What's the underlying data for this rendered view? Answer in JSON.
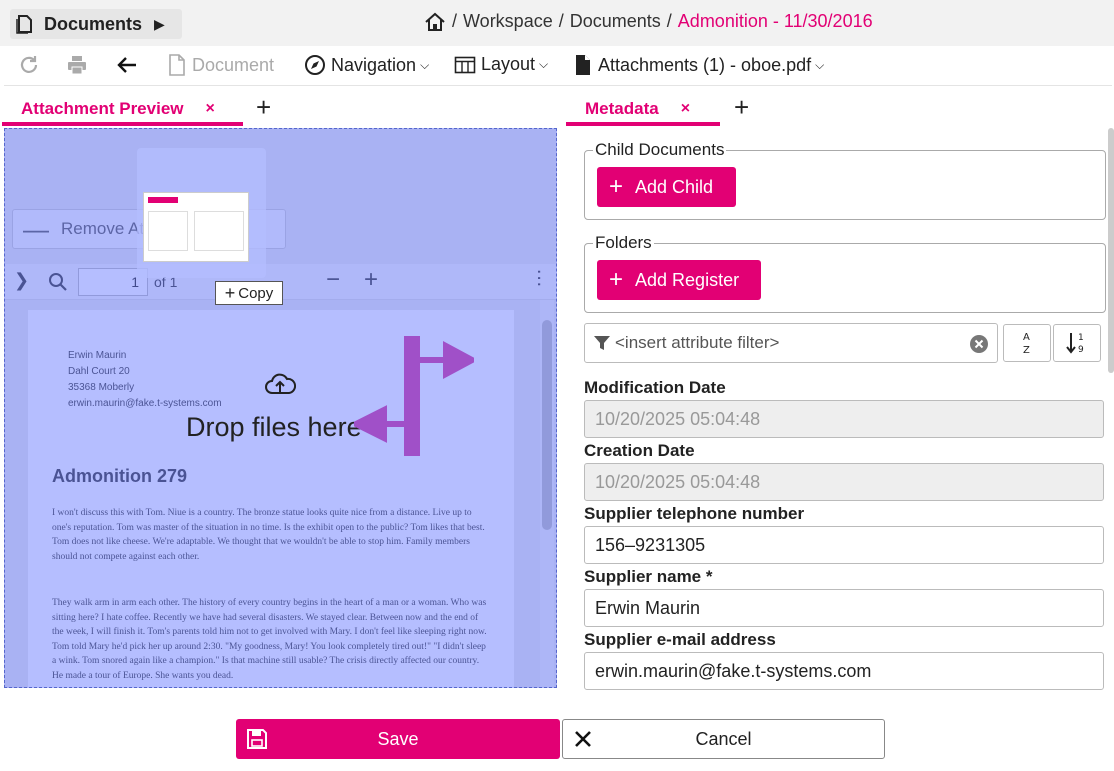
{
  "app": {
    "documents_label": "Documents"
  },
  "breadcrumb": {
    "items": [
      "Workspace",
      "Documents"
    ],
    "current": "Admonition - 11/30/2016",
    "separator": "/"
  },
  "toolbar": {
    "document_label": "Document",
    "navigation_label": "Navigation",
    "layout_label": "Layout",
    "attachments_label": "Attachments (1) - oboe.pdf"
  },
  "tabs": {
    "left": "Attachment Preview",
    "right": "Metadata",
    "close_glyph": "×",
    "add_glyph": "+"
  },
  "preview": {
    "remove_label": "Remove Attachment",
    "page_number": "1",
    "page_of": "of 1",
    "drop_text": "Drop files here",
    "copy_label": "Copy",
    "address": [
      "Erwin Maurin",
      "Dahl Court 20",
      "35368 Moberly",
      "erwin.maurin@fake.t-systems.com"
    ],
    "heading": "Admonition 279",
    "para1": "I won't discuss this with Tom. Niue is a country. The bronze statue looks quite nice from a distance. Live up to one's reputation. Tom was master of the situation in no time. Is the exhibit open to the public? Tom likes that best. Tom does not like cheese. We're adaptable. We thought that we wouldn't be able to stop him. Family members should not compete against each other.",
    "para2": "They walk arm in arm each other. The history of every country begins in the heart of a man or a woman. Who was sitting here? I hate coffee. Recently we have had several disasters. We stayed clear. Between now and the end of the week, I will finish it. Tom's parents told him not to get involved with Mary. I don't feel like sleeping right now. Tom told Mary he'd pick her up around 2:30. \"My goodness, Mary! You look completely tired out!\" \"I didn't sleep a wink. Tom snored again like a champion.\" Is that machine still usable? The crisis directly affected our country. He made a tour of Europe. She wants you dead."
  },
  "metadata": {
    "child_documents_legend": "Child Documents",
    "add_child_label": "Add Child",
    "folders_legend": "Folders",
    "add_register_label": "Add Register",
    "filter_placeholder": "<insert attribute filter>",
    "fields": [
      {
        "label": "Modification Date",
        "value": "10/20/2025 05:04:48"
      },
      {
        "label": "Creation Date",
        "value": "10/20/2025 05:04:48"
      },
      {
        "label": "Supplier telephone number",
        "value": "156–9231305"
      },
      {
        "label": "Supplier name *",
        "value": "Erwin Maurin"
      },
      {
        "label": "Supplier e-mail address",
        "value": "erwin.maurin@fake.t-systems.com"
      }
    ]
  },
  "footer": {
    "save_label": "Save",
    "cancel_label": "Cancel"
  },
  "colors": {
    "accent": "#e20074",
    "overlay": "#6478ff"
  }
}
